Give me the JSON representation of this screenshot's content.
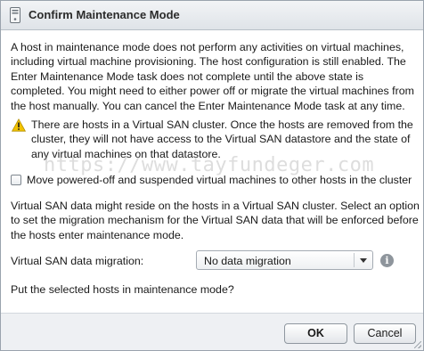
{
  "dialog": {
    "title": "Confirm Maintenance Mode",
    "icon": "host-icon"
  },
  "description": "A host in maintenance mode does not perform any activities on virtual machines, including virtual machine provisioning. The host configuration is still enabled. The Enter Maintenance Mode task does not complete until the above state is completed. You might need to either power off or migrate the virtual machines from the host manually. You can cancel the Enter Maintenance Mode task at any time.",
  "warning": {
    "icon": "warning-icon",
    "text": "There are hosts in a Virtual SAN cluster. Once the hosts are removed from the cluster, they will not have access to the Virtual SAN datastore and the state of any virtual machines on that datastore."
  },
  "move_checkbox": {
    "label": "Move powered-off and suspended virtual machines to other hosts in the cluster",
    "checked": false
  },
  "watermark": "https://www.tayfundeger.com",
  "vsan_info": "Virtual SAN data might reside on the hosts in a Virtual SAN cluster. Select an option to set the migration mechanism for the Virtual SAN data that will be enforced before the hosts enter maintenance mode.",
  "migration": {
    "label": "Virtual SAN data migration:",
    "selected": "No data migration",
    "info_icon": "info-icon"
  },
  "question": "Put the selected hosts in maintenance mode?",
  "buttons": {
    "ok": "OK",
    "cancel": "Cancel"
  },
  "colors": {
    "titlebar": "#dfe3e8",
    "footer": "#eef0f3",
    "warning_yellow": "#f2c200"
  }
}
